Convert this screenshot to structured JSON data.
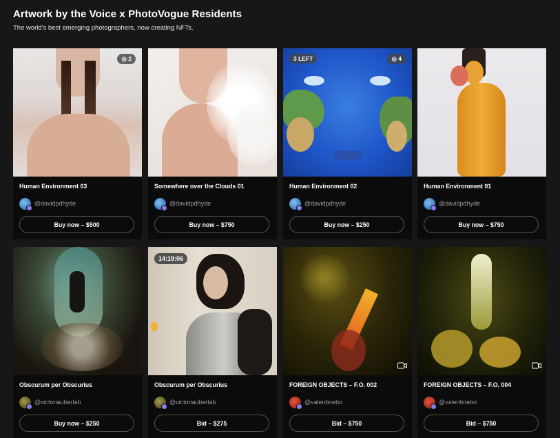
{
  "page": {
    "title": "Artwork by the Voice x PhotoVogue Residents",
    "subtitle": "The world's best emerging photographers, now creating NFTs."
  },
  "cards": [
    {
      "name": "Human Environment 03",
      "handle": "@davidpdhyde",
      "button": "Buy now – $500",
      "badge_right": "◎ 2",
      "badge_left": "",
      "timer": "",
      "video": false,
      "avatar": "blue"
    },
    {
      "name": "Somewhere over the Clouds 01",
      "handle": "@davidpdhyde",
      "button": "Buy now – $750",
      "badge_right": "",
      "badge_left": "",
      "timer": "",
      "video": false,
      "avatar": "blue"
    },
    {
      "name": "Human Environment 02",
      "handle": "@davidpdhyde",
      "button": "Buy now – $250",
      "badge_right": "◎ 4",
      "badge_left": "3 LEFT",
      "timer": "",
      "video": false,
      "avatar": "blue"
    },
    {
      "name": "Human Environment 01",
      "handle": "@davidpdhyde",
      "button": "Buy now – $750",
      "badge_right": "",
      "badge_left": "",
      "timer": "",
      "video": false,
      "avatar": "blue"
    },
    {
      "name": "Obscurum per Obscurius",
      "handle": "@victoriauberlab",
      "button": "Buy now – $250",
      "badge_right": "",
      "badge_left": "",
      "timer": "",
      "video": false,
      "avatar": "olive"
    },
    {
      "name": "Obscurum per Obscurius",
      "handle": "@victoriauberlab",
      "button": "Bid – $275",
      "badge_right": "",
      "badge_left": "",
      "timer": "14:19:06",
      "video": false,
      "avatar": "olive"
    },
    {
      "name": "FOREIGN OBJECTS – F.O. 002",
      "handle": "@valentinebo",
      "button": "Bid – $750",
      "badge_right": "",
      "badge_left": "",
      "timer": "",
      "video": true,
      "avatar": "red"
    },
    {
      "name": "FOREIGN OBJECTS – F.O. 004",
      "handle": "@valentinebo",
      "button": "Bid – $750",
      "badge_right": "",
      "badge_left": "",
      "timer": "",
      "video": true,
      "avatar": "red"
    }
  ],
  "colors": {
    "background": "#171717",
    "card": "#0b0b0b",
    "verified": "#8a7cf0"
  },
  "icons": {
    "edition": "edition-icon",
    "video": "video-camera-icon",
    "verified": "verified-badge-icon"
  }
}
